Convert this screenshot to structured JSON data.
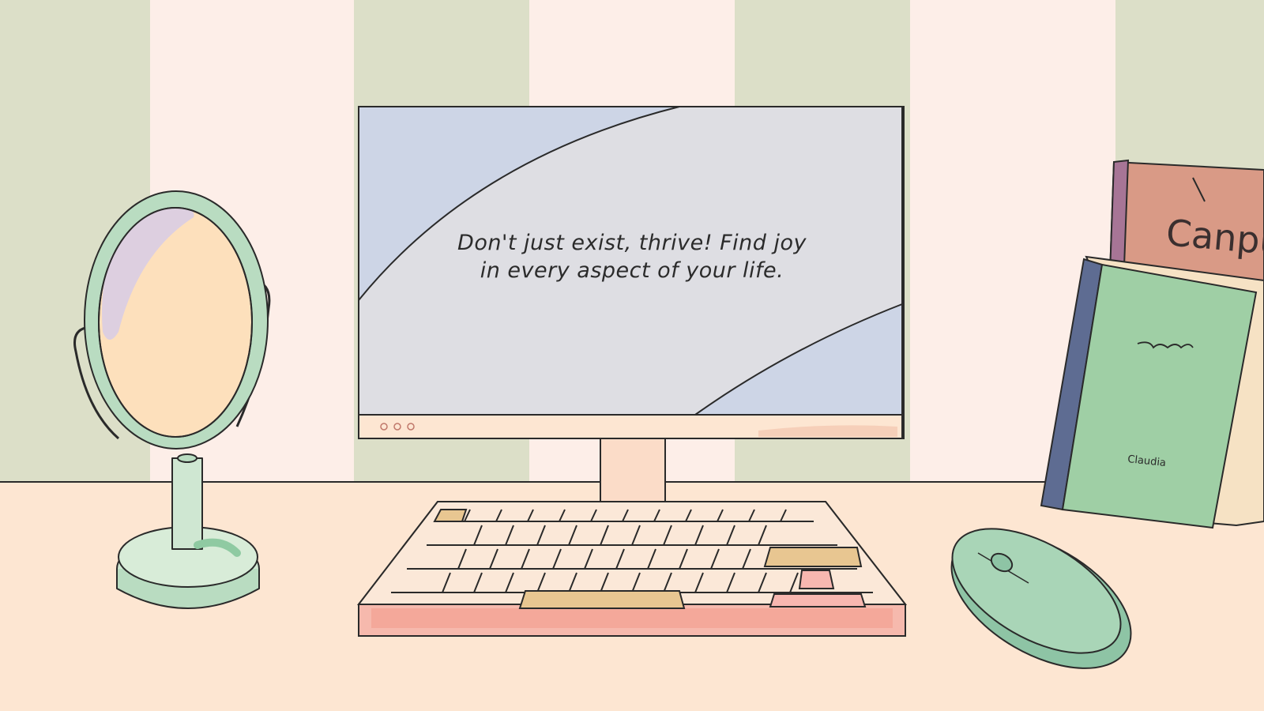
{
  "screen": {
    "quote_line1": "Don't just exist, thrive! Find joy",
    "quote_line2": "in every aspect of your life."
  },
  "books": {
    "back_cover_text": "Canpu",
    "front_name": "Claudia"
  },
  "colors": {
    "wall_green": "#dcdfc8",
    "wall_pink": "#fdeee8",
    "desk": "#fde6d2",
    "screen_blue": "#cdd5e6",
    "screen_gray": "#dedee3",
    "keyboard_pink": "#f6b9ad",
    "mint": "#a9d5b7"
  },
  "icons": [
    "mirror-icon",
    "monitor-icon",
    "keyboard-icon",
    "mouse-icon",
    "books-icon"
  ]
}
